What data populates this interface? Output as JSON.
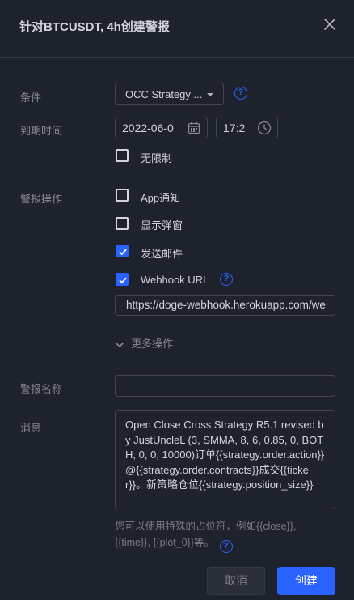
{
  "dialog": {
    "title": "针对BTCUSDT, 4h创建警报",
    "close_icon": "close-icon"
  },
  "condition": {
    "label": "条件",
    "value": "OCC Strategy ...",
    "help_icon": "help-icon"
  },
  "expiration": {
    "label": "到期时间",
    "date_value": "2022-06-0",
    "time_value": "17:2",
    "calendar_icon": "calendar-icon",
    "clock_icon": "clock-icon",
    "unlimited_label": "无限制",
    "unlimited_checked": false
  },
  "actions": {
    "label": "警报操作",
    "items": [
      {
        "label": "App通知",
        "checked": false
      },
      {
        "label": "显示弹窗",
        "checked": false
      },
      {
        "label": "发送邮件",
        "checked": true
      },
      {
        "label": "Webhook URL",
        "checked": true
      }
    ],
    "webhook_url": "https://doge-webhook.herokuapp.com/we",
    "more_label": "更多操作"
  },
  "alert_name": {
    "label": "警报名称",
    "value": ""
  },
  "message": {
    "label": "消息",
    "text": "Open Close Cross Strategy R5.1 revised by JustUncleL (3, SMMA, 8, 6, 0.85, 0, BOTH, 0, 0, 10000)订单{{strategy.order.action}}@{{strategy.order.contracts}}成交{{ticker}}。新策略仓位{{strategy.position_size}}",
    "hint": "您可以使用特殊的占位符，例如{{close}}, {{time}}, {{plot_0}}等。"
  },
  "footer": {
    "cancel_label": "取消",
    "create_label": "创建"
  },
  "colors": {
    "background": "#1e222d",
    "accent": "#2962ff",
    "border": "#434651",
    "muted_text": "#868993"
  }
}
